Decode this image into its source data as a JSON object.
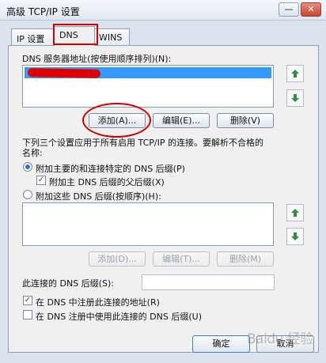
{
  "window": {
    "title": "高级 TCP/IP 设置",
    "minimize_icon": "minus-icon",
    "close_icon": "close-icon",
    "minimize_label": "—",
    "close_label": "✕"
  },
  "tabs": [
    {
      "label": "IP 设置"
    },
    {
      "label": "DNS"
    },
    {
      "label": "WINS"
    }
  ],
  "dns": {
    "servers_label": "DNS 服务器地址(按使用顺序排列)(N):",
    "servers": [
      "[redacted]"
    ],
    "add_button": "添加(A)...",
    "edit_button": "编辑(E)...",
    "delete_button": "删除(V)"
  },
  "suffix": {
    "description_line1": "下列三个设置应用于所有启用 TCP/IP 的连接。要解析不合格的",
    "description_line2": "名称:",
    "option1": "附加主要的和连接特定的 DNS 后缀(P)",
    "option1_selected": true,
    "option1_sub": "附加主 DNS 后缀的父后缀(X)",
    "option1_sub_checked": true,
    "option2": "附加这些 DNS 后缀(按顺序)(H):",
    "option2_selected": false,
    "add_button": "添加(D)...",
    "edit_button": "编辑(T)...",
    "delete_button": "删除(M)"
  },
  "connection": {
    "suffix_label": "此连接的 DNS 后缀(S):",
    "suffix_value": "",
    "register_label": "在 DNS 中注册此连接的地址(R)",
    "register_checked": true,
    "use_suffix_label": "在 DNS 注册中使用此连接的 DNS 后缀(U)",
    "use_suffix_checked": false
  },
  "footer": {
    "ok_button": "确定",
    "cancel_button": "取消"
  },
  "watermark": "Baidu 经验",
  "colors": {
    "accent": "#3399ff",
    "annotation_red": "#d40000",
    "arrow_green": "#2f8f3a"
  }
}
